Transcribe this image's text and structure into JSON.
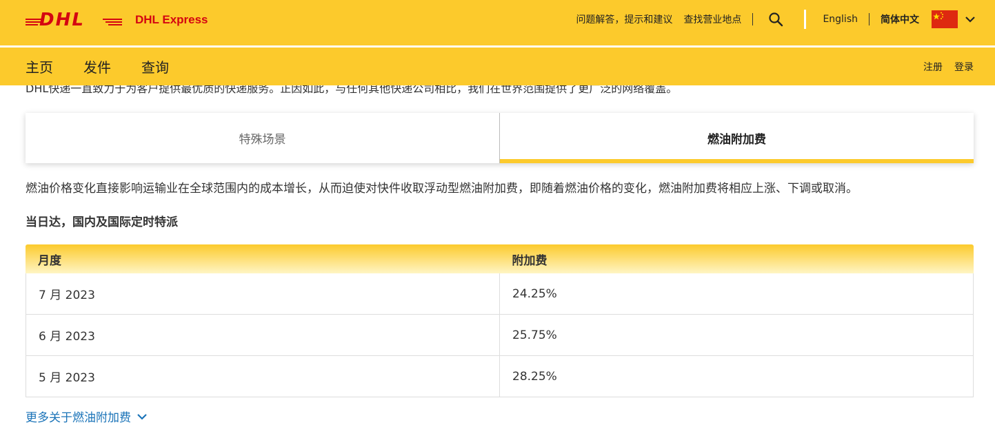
{
  "header": {
    "logo_text": "DHL",
    "brand_name": "DHL Express",
    "links": {
      "faq": "问题解答，提示和建议",
      "locations": "查找营业地点",
      "lang_en": "English",
      "lang_zh": "简体中文"
    },
    "search_icon": "search-icon",
    "flag_icon": "china-flag-icon"
  },
  "nav": {
    "items": [
      "主页",
      "发件",
      "查询"
    ],
    "register": "注册",
    "login": "登录"
  },
  "intro_text": "DHL快递一直致力于为客户提供最优质的快递服务。正因如此，与任何其他快递公司相比，我们在世界范围提供了更广泛的网络覆盖。",
  "tabs": [
    {
      "label": "特殊场景",
      "active": false
    },
    {
      "label": "燃油附加费",
      "active": true
    }
  ],
  "description": "燃油价格变化直接影响运输业在全球范围内的成本增长，从而迫使对快件收取浮动型燃油附加费，即随着燃油价格的变化，燃油附加费将相应上涨、下调或取消。",
  "section_title": "当日达，国内及国际定时特派",
  "table": {
    "headers": [
      "月度",
      "附加费"
    ],
    "rows": [
      [
        "7 月 2023",
        "24.25%"
      ],
      [
        "6 月 2023",
        "25.75%"
      ],
      [
        "5 月 2023",
        "28.25%"
      ]
    ]
  },
  "more_link": "更多关于燃油附加费",
  "colors": {
    "dhl_yellow": "#fcca2c",
    "dhl_red": "#d40511",
    "link_blue": "#1a73b8"
  }
}
